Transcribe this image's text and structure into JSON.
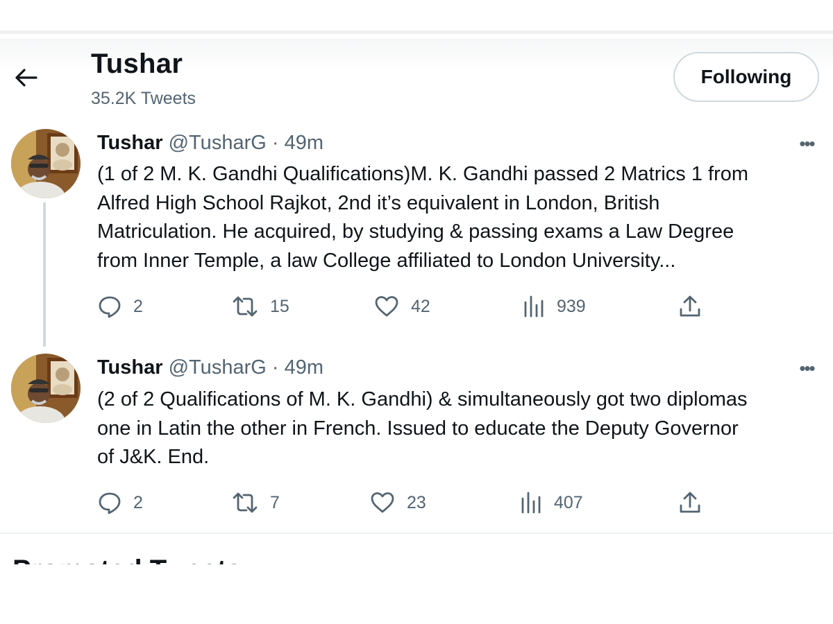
{
  "header": {
    "title": "Tushar",
    "tweet_count": "35.2K Tweets",
    "follow_label": "Following",
    "back_icon": "arrow-left-icon"
  },
  "tweets": [
    {
      "name": "Tushar",
      "handle": "@TusharG",
      "time": "· 49m",
      "text": "(1 of 2 M. K. Gandhi Qualifications)M. K. Gandhi passed 2 Matrics 1 from\nAlfred High School Rajkot, 2nd it’s equivalent in London, British\nMatriculation. He acquired, by studying & passing exams a Law Degree\nfrom Inner Temple, a law College affiliated to London University...",
      "replies": "2",
      "retweets": "15",
      "likes": "42",
      "views": "939"
    },
    {
      "name": "Tushar",
      "handle": "@TusharG",
      "time": "· 49m",
      "text": "(2 of 2 Qualifications of M. K. Gandhi) &  simultaneously got two diplomas\none in Latin the other in French. Issued to educate the Deputy Governor\nof J&K. End.",
      "replies": "2",
      "retweets": "7",
      "likes": "23",
      "views": "407"
    }
  ],
  "section_heading": "Promoted Tweets",
  "icons": {
    "more": "more-horizontal-icon",
    "reply": "reply-icon",
    "retweet": "retweet-icon",
    "like": "heart-icon",
    "views": "views-chart-icon",
    "share": "share-icon"
  },
  "colors": {
    "text": "#0f1419",
    "muted": "#536471",
    "border": "#cfd9de"
  }
}
